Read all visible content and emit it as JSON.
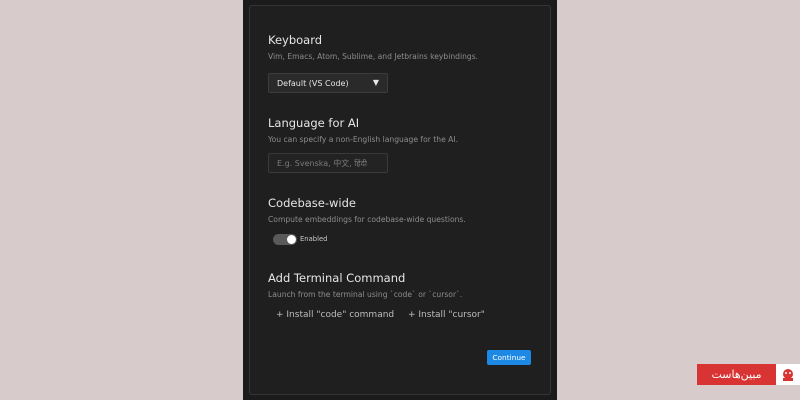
{
  "keyboard": {
    "title": "Keyboard",
    "description": "Vim, Emacs, Atom, Sublime, and Jetbrains keybindings.",
    "selected": "Default (VS Code)"
  },
  "language": {
    "title": "Language for AI",
    "description": "You can specify a non-English language for the AI.",
    "placeholder": "E.g. Svenska, 中文, हिंदी"
  },
  "codebase": {
    "title": "Codebase-wide",
    "description": "Compute embeddings for codebase-wide questions.",
    "toggle_label": "Enabled",
    "enabled": true
  },
  "terminal": {
    "title": "Add Terminal Command",
    "description": "Launch from the terminal using `code` or `cursor`.",
    "install_code": "+ Install \"code\" command",
    "install_cursor": "+ Install \"cursor\""
  },
  "continue_label": "Continue",
  "watermark": {
    "text": "مبین‌هاست"
  },
  "colors": {
    "accent": "#1e88e5",
    "watermark": "#d93434",
    "background": "#d7cbcb"
  }
}
